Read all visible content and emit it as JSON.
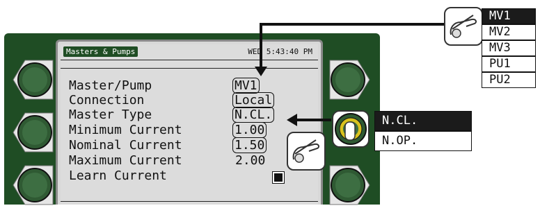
{
  "screen": {
    "title": "Masters & Pumps",
    "clock": "WED 5:43:40 PM"
  },
  "rows": [
    {
      "label": "Master/Pump",
      "value": "MV1",
      "boxed": true
    },
    {
      "label": "Connection",
      "value": "Local",
      "boxed": true
    },
    {
      "label": "Master Type",
      "value": "N.CL.",
      "boxed": true
    },
    {
      "label": "Minimum Current",
      "value": "1.00",
      "boxed": true
    },
    {
      "label": "Nominal Current",
      "value": "1.50",
      "boxed": true
    },
    {
      "label": "Maximum Current",
      "value": "2.00",
      "boxed": false
    },
    {
      "label": "Learn Current",
      "value": "",
      "boxed": false
    }
  ],
  "master_pump_options": {
    "options": [
      "MV1",
      "MV2",
      "MV3",
      "PU1",
      "PU2"
    ],
    "selected": "MV1"
  },
  "master_type_options": {
    "options": [
      "N.CL.",
      "N.OP."
    ],
    "selected": "N.CL."
  },
  "colors": {
    "housing": "#1f4d24",
    "lcd": "#dcdcdc",
    "selected_option": "#1b1b1b"
  }
}
